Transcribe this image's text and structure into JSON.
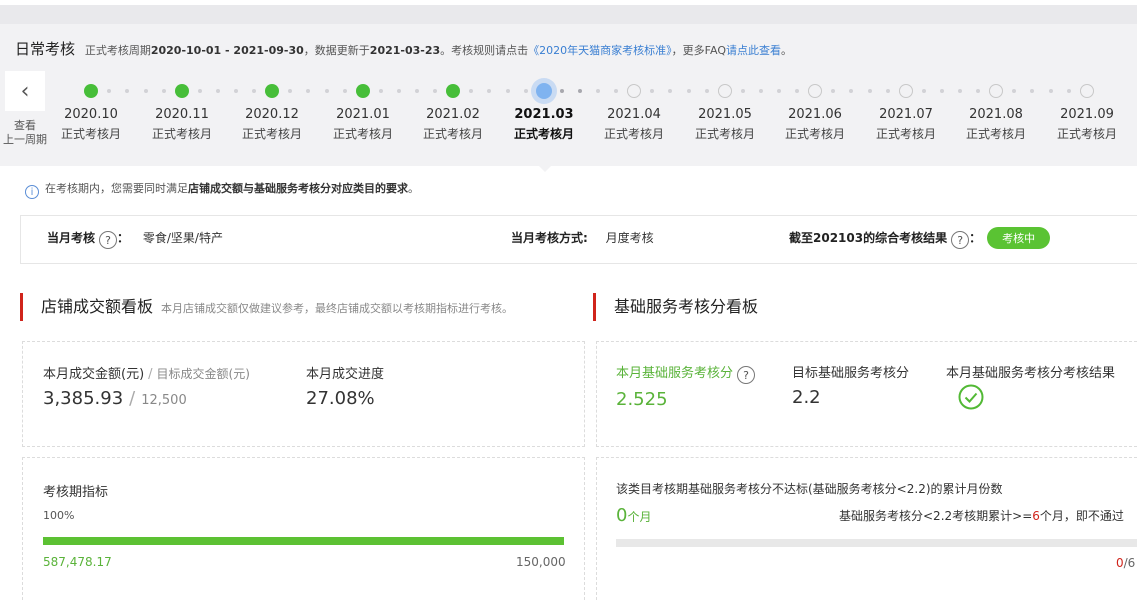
{
  "header": {
    "title": "日常考核",
    "info_prefix": "正式考核周期",
    "period": "2020-10-01 - 2021-09-30",
    "update_prefix": "，数据更新于",
    "update_date": "2021-03-23",
    "rule_prefix": "。考核规则请点击",
    "rule_link": "《2020年天猫商家考核标准》",
    "faq_prefix": "，更多FAQ",
    "faq_link": "请点此查看",
    "faq_suffix": "。"
  },
  "timeline": {
    "back_label_1": "查看",
    "back_label_2": "上一周期",
    "months": [
      {
        "month": "2020.10",
        "sub": "正式考核月",
        "status": "done"
      },
      {
        "month": "2020.11",
        "sub": "正式考核月",
        "status": "done"
      },
      {
        "month": "2020.12",
        "sub": "正式考核月",
        "status": "done"
      },
      {
        "month": "2021.01",
        "sub": "正式考核月",
        "status": "done"
      },
      {
        "month": "2021.02",
        "sub": "正式考核月",
        "status": "done"
      },
      {
        "month": "2021.03",
        "sub": "正式考核月",
        "status": "current"
      },
      {
        "month": "2021.04",
        "sub": "正式考核月",
        "status": "future"
      },
      {
        "month": "2021.05",
        "sub": "正式考核月",
        "status": "future"
      },
      {
        "month": "2021.06",
        "sub": "正式考核月",
        "status": "future"
      },
      {
        "month": "2021.07",
        "sub": "正式考核月",
        "status": "future"
      },
      {
        "month": "2021.08",
        "sub": "正式考核月",
        "status": "future"
      },
      {
        "month": "2021.09",
        "sub": "正式考核月",
        "status": "future"
      }
    ]
  },
  "notice": {
    "icon": "info-icon",
    "glyph": "i",
    "pre": "在考核期内，您需要同时满足",
    "bold": "店铺成交额与基础服务考核分对应类目的要求",
    "post": "。"
  },
  "summary": {
    "assess_label": "当月考核",
    "q_glyph": "?",
    "colon": "：",
    "category": "零食/坚果/特产",
    "method_label": "当月考核方式:",
    "method_value": "月度考核",
    "result_label": "截至202103的综合考核结果",
    "result_badge": "考核中"
  },
  "sales": {
    "title": "店铺成交额看板",
    "note": "本月店铺成交额仅做建议参考，最终店铺成交额以考核期指标进行考核。",
    "amount_label": "本月成交金额(元)",
    "sep": "/",
    "target_label": "目标成交金额(元)",
    "amount": "3,385.93",
    "target": "12,500",
    "progress_label": "本月成交进度",
    "progress": "27.08%",
    "period_label": "考核期指标",
    "period_pct": "100%",
    "period_fraction": 1,
    "period_value": "587,478.17",
    "period_target": "150,000"
  },
  "service": {
    "title": "基础服务考核分看板",
    "score_label": "本月基础服务考核分",
    "score": "2.525",
    "target_label": "目标基础服务考核分",
    "target": "2.2",
    "result_label": "本月基础服务考核分考核结果",
    "result_icon": "check-circle-icon",
    "fail_label": "该类目考核期基础服务考核分不达标(基础服务考核分<2.2)的累计月份数",
    "fail_count": "0",
    "fail_unit": "个月",
    "rule_pre": "基础服务考核分<2.2考核期累计>=",
    "rule_num": "6",
    "rule_post": "个月，即不通过",
    "ratio_num": "0",
    "ratio_den": "/6"
  },
  "colors": {
    "done": "#47be39",
    "current": "#7fb3f0",
    "accent_red": "#d0241b",
    "link": "#3a7fd2",
    "green_text": "#5ab33a"
  }
}
